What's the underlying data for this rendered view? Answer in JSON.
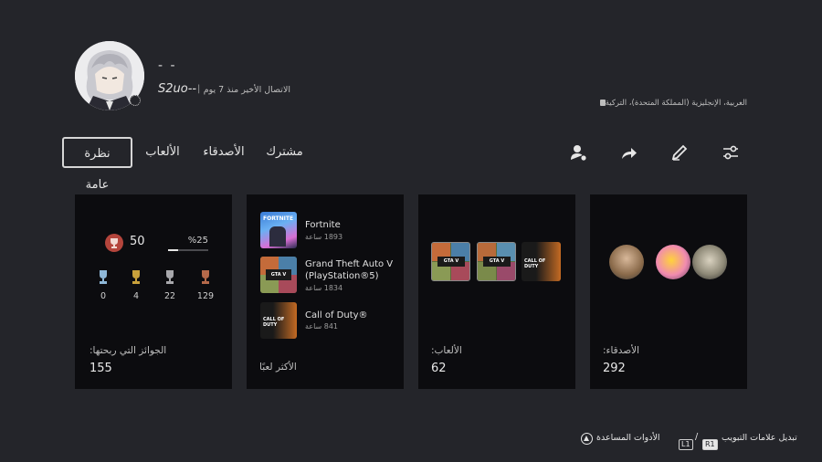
{
  "profile": {
    "display_name": "- -",
    "online_id": "S2uo--",
    "last_online": "الاتصال الأخير منذ 7 يوم",
    "separator": "|",
    "languages": "العربية، الإنجليزية (المملكة المتحدة)، التركية"
  },
  "tabs": [
    {
      "label": "نظرة عامة",
      "active": true
    },
    {
      "label": "الألعاب",
      "active": false
    },
    {
      "label": "الأصدقاء",
      "active": false
    },
    {
      "label": "مشترك",
      "active": false
    }
  ],
  "actions": [
    "add-friend-icon",
    "share-icon",
    "edit-icon",
    "settings-sliders-icon"
  ],
  "trophies": {
    "level": "50",
    "progress_text": "%25",
    "progress": 0.25,
    "counts": [
      {
        "type": "platinum",
        "value": "0"
      },
      {
        "type": "gold",
        "value": "4"
      },
      {
        "type": "silver",
        "value": "22"
      },
      {
        "type": "bronze",
        "value": "129"
      }
    ],
    "label": "الجوائز التي ربحتها:",
    "total": "155"
  },
  "most_played": {
    "label": "الأكثر لعبًا",
    "games": [
      {
        "title": "Fortnite",
        "hours": "1893 ساعة"
      },
      {
        "title": "Grand Theft Auto V (PlayStation®5)",
        "hours": "1834 ساعة"
      },
      {
        "title": "Call of Duty®",
        "hours": "841 ساعة"
      }
    ]
  },
  "games": {
    "label": "الألعاب:",
    "count": "62"
  },
  "friends": {
    "label": "الأصدقاء:",
    "count": "292"
  },
  "footer": {
    "switch_tabs": "تبديل علامات التبويب",
    "r1": "R1",
    "slash": "/",
    "l1": "L1",
    "tools": "الأدوات المساعدة"
  },
  "colors": {
    "background": "#24252a",
    "card": "#0c0c0f",
    "trophy_red": "#b4453c"
  }
}
